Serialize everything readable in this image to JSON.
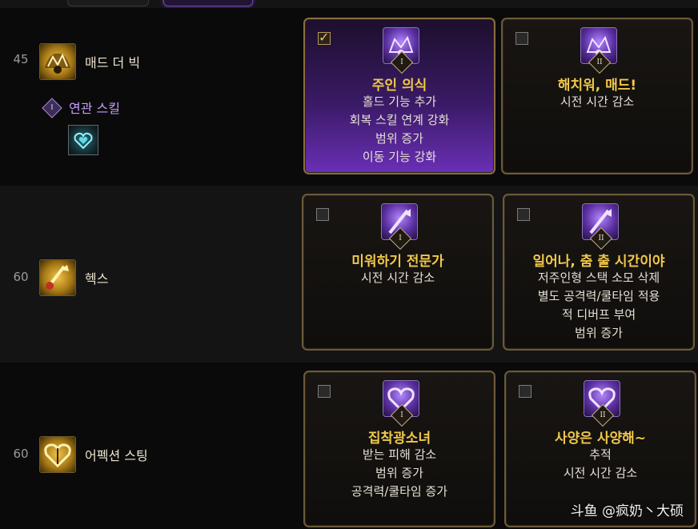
{
  "skills": [
    {
      "level": "45",
      "name": "매드 더 빅",
      "related_label": "연관 스킬",
      "related_numeral": "I",
      "icon": "mad-the-big-icon",
      "options": [
        {
          "numeral": "I",
          "title": "주인 의식",
          "lines": [
            "홀드 기능 추가",
            "회복 스킬 연계 강화",
            "범위 증가",
            "이동 기능 강화"
          ],
          "selected": true
        },
        {
          "numeral": "II",
          "title": "해치워, 매드!",
          "lines": [
            "시전 시간 감소"
          ],
          "selected": false
        }
      ]
    },
    {
      "level": "60",
      "name": "헥스",
      "icon": "hex-icon",
      "options": [
        {
          "numeral": "I",
          "title": "미워하기 전문가",
          "lines": [
            "시전 시간 감소"
          ],
          "selected": false
        },
        {
          "numeral": "II",
          "title": "일어나, 춤 출 시간이야",
          "lines": [
            "저주인형 스택 소모 삭제",
            "별도 공격력/쿨타임 적용",
            "적 디버프 부여",
            "범위 증가"
          ],
          "selected": false
        }
      ]
    },
    {
      "level": "60",
      "name": "어펙션 스팅",
      "icon": "affection-sting-icon",
      "options": [
        {
          "numeral": "I",
          "title": "집착광소녀",
          "lines": [
            "받는 피해 감소",
            "범위 증가",
            "공격력/쿨타임 증가"
          ],
          "selected": false
        },
        {
          "numeral": "II",
          "title": "사양은 사양해~",
          "lines": [
            "추적",
            "시전 시간 감소"
          ],
          "selected": false
        }
      ]
    }
  ],
  "watermark": "斗鱼 @疯奶丶大硕",
  "colors": {
    "accent_gold": "#f0c84a",
    "selected_purple": "#6a2fb6",
    "related_purple": "#c79dff"
  }
}
